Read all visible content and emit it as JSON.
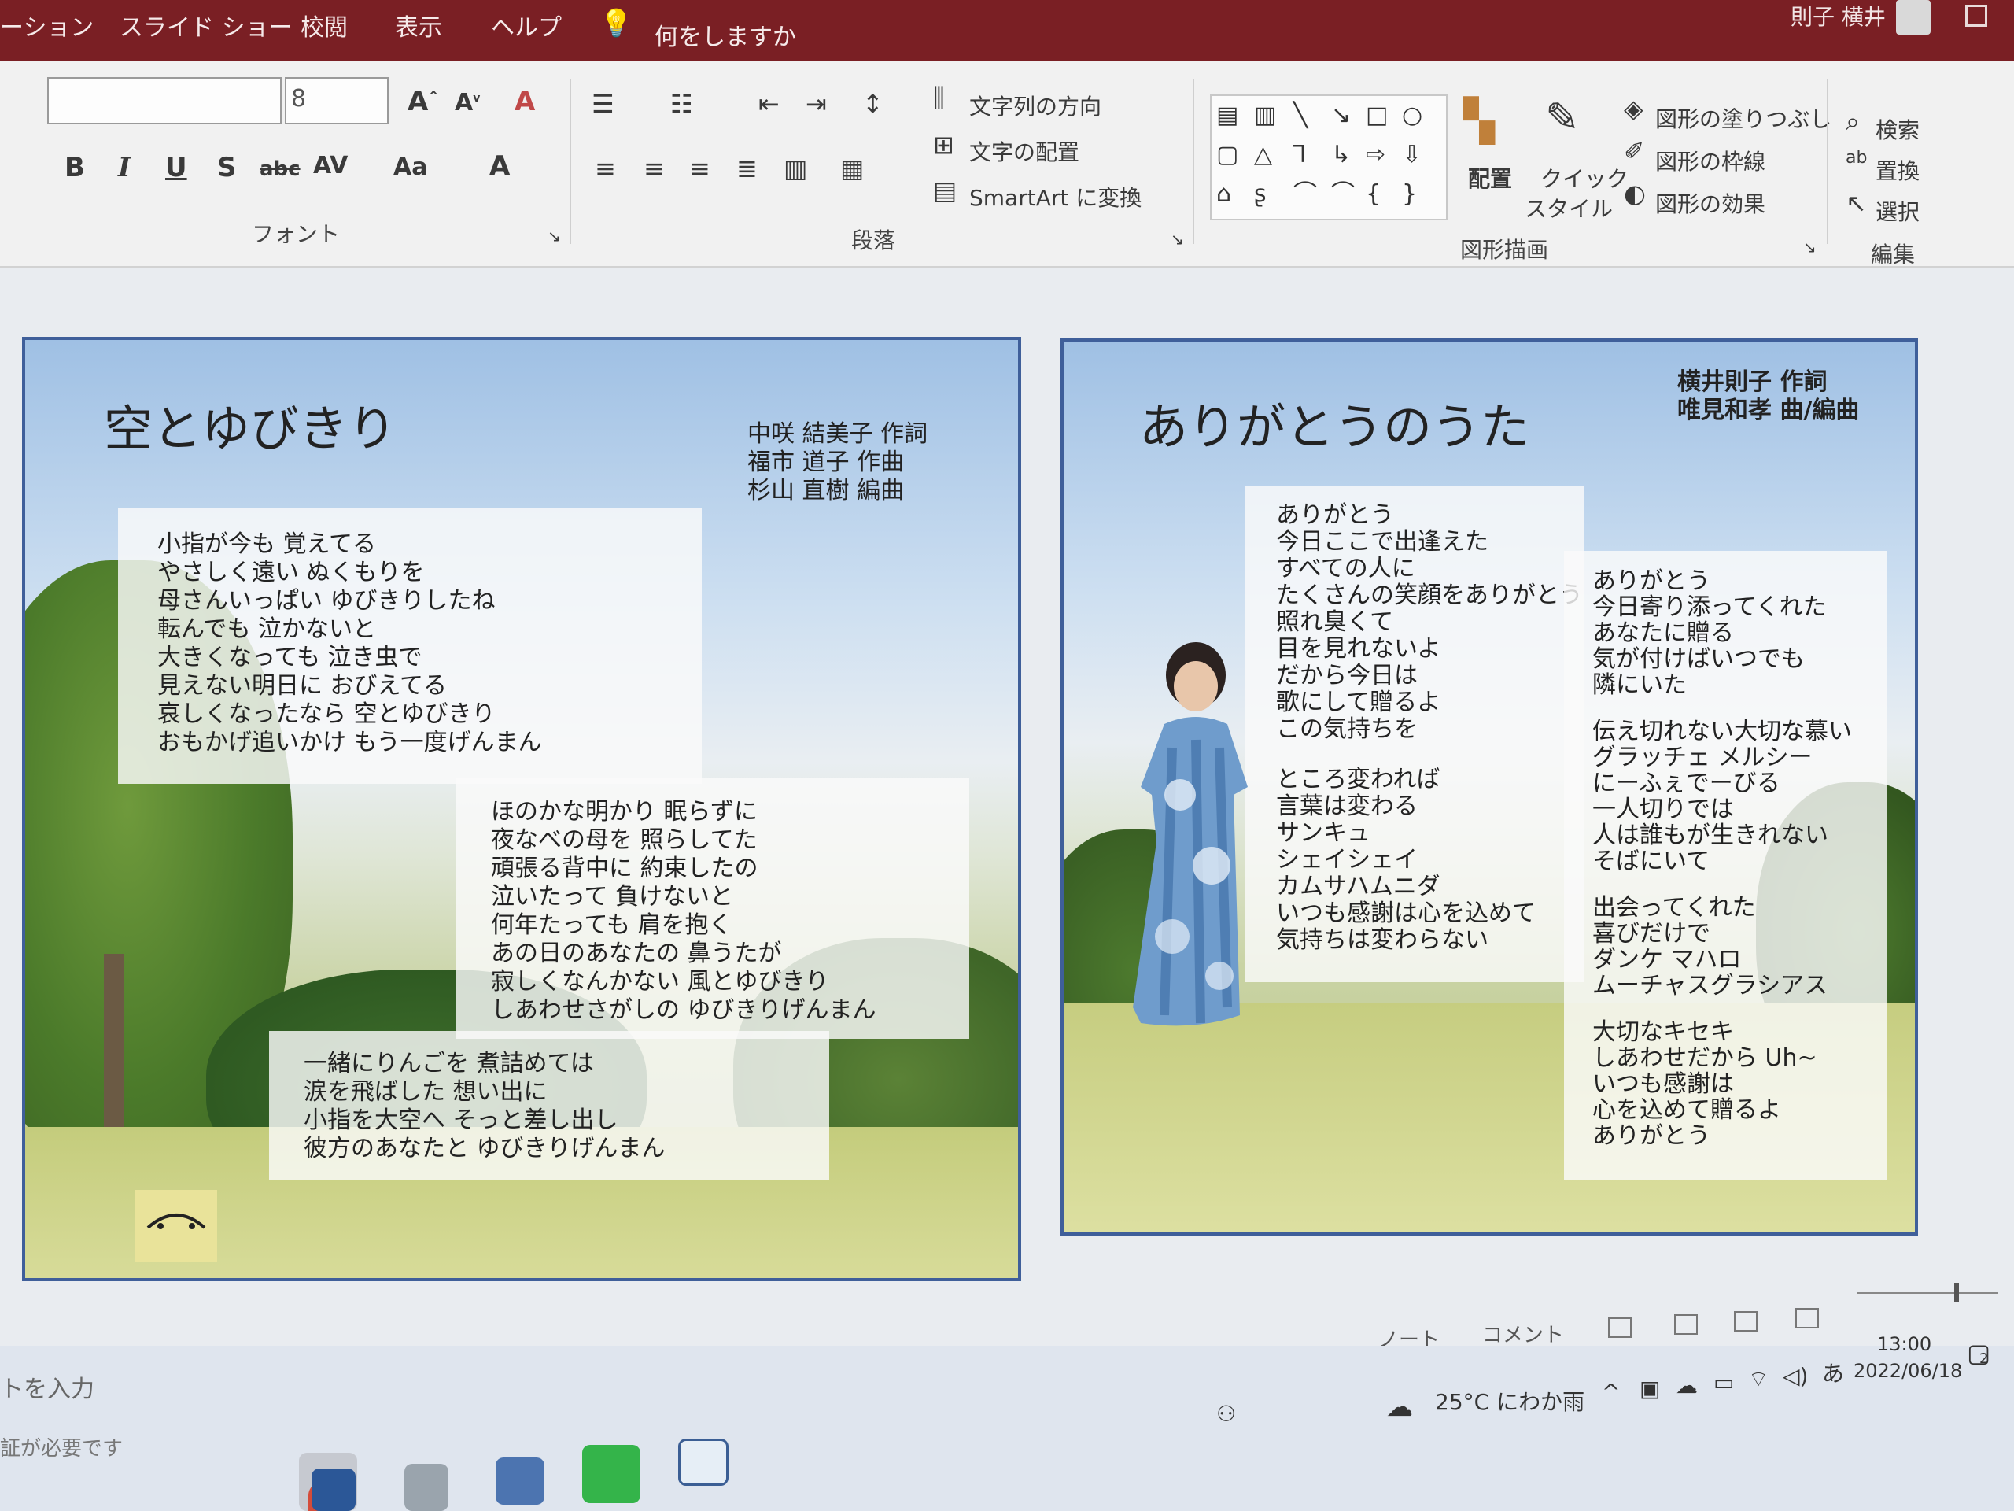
{
  "menubar": {
    "items": [
      "ーション",
      "スライド ショー",
      "校閲",
      "表示",
      "ヘルプ"
    ],
    "tell_me": "何をしますか",
    "user": "則子 横井"
  },
  "ribbon": {
    "font_group": {
      "label": "フォント",
      "font_name": "",
      "font_size": "8",
      "buttons": [
        "B",
        "I",
        "U",
        "S",
        "abc",
        "AV",
        "Aa",
        "A"
      ]
    },
    "paragraph_group": {
      "label": "段落",
      "text_direction": "文字列の方向",
      "align_text": "文字の配置",
      "smartart": "SmartArt に変換"
    },
    "drawing_group": {
      "label": "図形描画",
      "arrange": "配置",
      "quick_style_1": "クイック",
      "quick_style_2": "スタイル",
      "shape_fill": "図形の塗りつぶし",
      "shape_outline": "図形の枠線",
      "shape_effects": "図形の効果"
    },
    "editing_group": {
      "label": "編集",
      "find": "検索",
      "replace": "置換",
      "select": "選択"
    }
  },
  "slide_left": {
    "title": "空とゆびきり",
    "credits": [
      "中咲 結美子 作詞",
      "福市 道子 作曲",
      "杉山 直樹 編曲"
    ],
    "verse1": [
      "小指が今も 覚えてる",
      "やさしく遠い ぬくもりを",
      "母さんいっぱい ゆびきりしたね",
      "転んでも 泣かないと",
      "大きくなっても 泣き虫で",
      "見えない明日に おびえてる",
      "哀しくなったなら 空とゆびきり",
      "おもかげ追いかけ もう一度げんまん"
    ],
    "verse2": [
      "ほのかな明かり 眠らずに",
      "夜なべの母を 照らしてた",
      "頑張る背中に 約束したの",
      "泣いたって 負けないと",
      "何年たっても 肩を抱く",
      "あの日のあなたの 鼻うたが",
      "寂しくなんかない 風とゆびきり",
      "しあわせさがしの ゆびきりげんまん"
    ],
    "verse3": [
      "一緒にりんごを 煮詰めては",
      "涙を飛ばした 想い出に",
      "小指を大空へ そっと差し出し",
      "彼方のあなたと ゆびきりげんまん"
    ]
  },
  "slide_right": {
    "title": "ありがとうのうた",
    "credits": [
      "横井則子 作詞",
      "唯見和孝 曲/編曲"
    ],
    "verse1": [
      "ありがとう",
      "今日ここで出逢えた",
      "すべての人に",
      "たくさんの笑顔をありがとう",
      "照れ臭くて",
      "目を見れないよ",
      "だから今日は",
      "歌にして贈るよ",
      "この気持ちを",
      "",
      "ところ変われば",
      "言葉は変わる",
      "サンキュ",
      "シェイシェイ",
      "カムサハムニダ",
      "いつも感謝は心を込めて",
      "気持ちは変わらない"
    ],
    "verse2": [
      "ありがとう",
      "今日寄り添ってくれた",
      "あなたに贈る",
      "気が付けばいつでも",
      "隣にいた",
      "",
      "伝え切れない大切な慕い",
      "グラッチェ メルシー",
      "にーふぇでーびる",
      "一人切りでは",
      "人は誰もが生きれない",
      "そばにいて",
      "",
      "出会ってくれた",
      "喜びだけで",
      "ダンケ マハロ",
      "ムーチャスグラシアス",
      "",
      "大切なキセキ",
      "しあわせだから Uh~",
      "いつも感謝は",
      "心を込めて贈るよ",
      "ありがとう"
    ]
  },
  "statusbar": {
    "notes": "ノート",
    "comments": "コメント"
  },
  "taskbar": {
    "search_placeholder": "トを入力",
    "license_note": "証が必要です",
    "weather": "25°C にわか雨",
    "ime": "あ",
    "time": "13:00",
    "date": "2022/06/18",
    "notification_count": "2"
  }
}
